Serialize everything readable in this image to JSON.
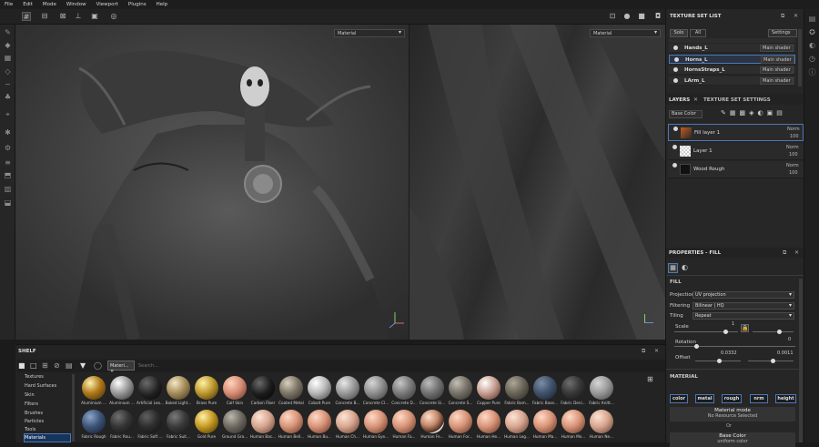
{
  "menu": [
    "File",
    "Edit",
    "Mode",
    "Window",
    "Viewport",
    "Plugins",
    "Help"
  ],
  "viewports": {
    "left_mode": "Material",
    "right_mode": "Material"
  },
  "texture_set_list": {
    "title": "TEXTURE SET LIST",
    "tabs": [
      "Solo",
      "All"
    ],
    "settings_label": "Settings",
    "rows": [
      {
        "name": "Hands_L",
        "shader": "Main shader"
      },
      {
        "name": "Horns_L",
        "shader": "Main shader"
      },
      {
        "name": "HornsStraps_L",
        "shader": "Main shader"
      },
      {
        "name": "LArm_L",
        "shader": "Main shader"
      }
    ]
  },
  "layers": {
    "tab_layers": "LAYERS",
    "tab_tss": "TEXTURE SET SETTINGS",
    "channel": "Base Color",
    "rows": [
      {
        "name": "Fill layer 1",
        "blend": "Norm",
        "opacity": "100"
      },
      {
        "name": "Layer 1",
        "blend": "Norm",
        "opacity": "100"
      },
      {
        "name": "Wood Rough",
        "blend": "Norm",
        "opacity": "100"
      }
    ]
  },
  "properties": {
    "title": "PROPERTIES - FILL",
    "fill_section": "FILL",
    "projection_label": "Projection",
    "projection_value": "UV projection",
    "filtering_label": "Filtering",
    "filtering_value": "Bilinear | HQ",
    "tiling_label": "Tiling",
    "tiling_value": "Repeat",
    "scale_label": "Scale",
    "scale_value": "1",
    "rotation_label": "Rotation",
    "rotation_value": "0",
    "offset_label": "Offset",
    "offset_x": "0.0332",
    "offset_y": "0.0011",
    "material_section": "MATERIAL",
    "channels": [
      "color",
      "metal",
      "rough",
      "nrm",
      "height"
    ],
    "material_mode_title": "Material mode",
    "material_mode_value": "No Resource Selected",
    "or_label": "Or",
    "base_color_title": "Base Color",
    "base_color_value": "uniform color"
  },
  "shelf": {
    "title": "SHELF",
    "filter_tag": "Materi...",
    "search_placeholder": "Search...",
    "categories": [
      "Textures",
      "Hard Surfaces",
      "Skin",
      "Filters",
      "Brushes",
      "Particles",
      "Tools",
      "Materials"
    ],
    "selected_category": "Materials",
    "row1": [
      "Aluminium ...",
      "Aluminium ...",
      "Artificial Lea...",
      "Baked Light...",
      "Brass Pure",
      "Calf Skin",
      "Carbon Fiber",
      "Coated Metal",
      "Cobalt Pure",
      "Concrete B...",
      "Concrete Cl...",
      "Concrete D...",
      "Concrete Si...",
      "Concrete S...",
      "Copper Pure",
      "Fabric Bam...",
      "Fabric Base...",
      "Fabric Deni...",
      "Fabric Knitt..."
    ],
    "row2": [
      "Fabric Rough",
      "Fabric Rou...",
      "Fabric Soft ...",
      "Fabric Suit...",
      "Gold Pure",
      "Ground Gra...",
      "Human Bac...",
      "Human Bell...",
      "Human Bu...",
      "Human Ch...",
      "Human Eye...",
      "Human Fa...",
      "Human Fe...",
      "Human For...",
      "Human He...",
      "Human Leg...",
      "Human Ma...",
      "Human Mo...",
      "Human Ne..."
    ]
  },
  "colors": {
    "accent": "#4c79b9",
    "panel": "#262626",
    "viewport": "#474747"
  }
}
